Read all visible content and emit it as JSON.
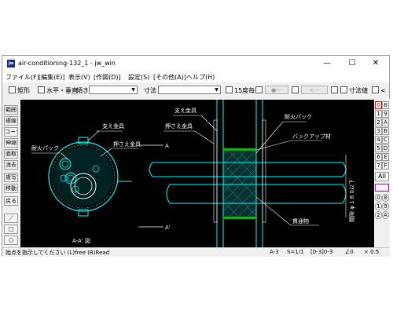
{
  "window": {
    "title": "air-conditioning-132_1 - jw_win",
    "icon_label": "jw",
    "controls": [
      "—",
      "☐",
      "✕"
    ]
  },
  "menu": [
    "ファイル(F)",
    "[編集(E)]",
    "表示(V)",
    "[作図(D)]",
    "設定(S)",
    "[その他(A)]",
    "ヘルプ(H)"
  ],
  "toolbar": {
    "rect_label": "矩形",
    "horiz_label": "水平・垂直",
    "slope_label": "傾き",
    "slope_value": "",
    "dim_label": "寸法",
    "dim_value": "",
    "deg15_label": "15度毎",
    "circle_btn": "●---",
    "arrow_btn": "<---",
    "dimval_label": "寸法値",
    "last_label": "<"
  },
  "left_tools": [
    "範囲",
    "複線",
    "コーナー",
    "伸縮",
    "面取",
    "消去",
    "複写",
    "移動",
    "戻る",
    "／",
    "□",
    "○"
  ],
  "right_layers": [
    [
      "0",
      "8"
    ],
    [
      "1",
      "9"
    ],
    [
      "2",
      "A"
    ],
    [
      "3",
      "B"
    ],
    [
      "4",
      "C"
    ],
    [
      "5",
      "D"
    ],
    [
      "6",
      "E"
    ],
    [
      "7",
      "F"
    ]
  ],
  "right_all": "All",
  "right_bottom": [
    [
      "0",
      "8"
    ],
    [
      "1",
      "9"
    ],
    [
      "2",
      "A"
    ]
  ],
  "drawing": {
    "left_labels": {
      "support": "支え金具",
      "press": "押さえ金具",
      "fire": "耐火パック",
      "section": "A-A' 図"
    },
    "right_labels": {
      "support": "支え金具",
      "press": "押さえ金具",
      "fire": "耐火パック",
      "backup": "バックアップ材",
      "a_top": "A",
      "a_bottom": "A'",
      "through": "貫通物",
      "clearance": "間隙 φ 1 6 0以下"
    }
  },
  "status": {
    "message": "始点を指示してください (L)free (R)Read",
    "paper": "A-3",
    "scale": "S=1/1",
    "layer": "[0-3]0-3",
    "angle": "∠0",
    "zoom": "× 0.5"
  },
  "colors": {
    "canvas": "#000000",
    "cyan": "#00ffff",
    "green": "#00c000",
    "white": "#ffffff",
    "red_layer": "#ff0000"
  }
}
